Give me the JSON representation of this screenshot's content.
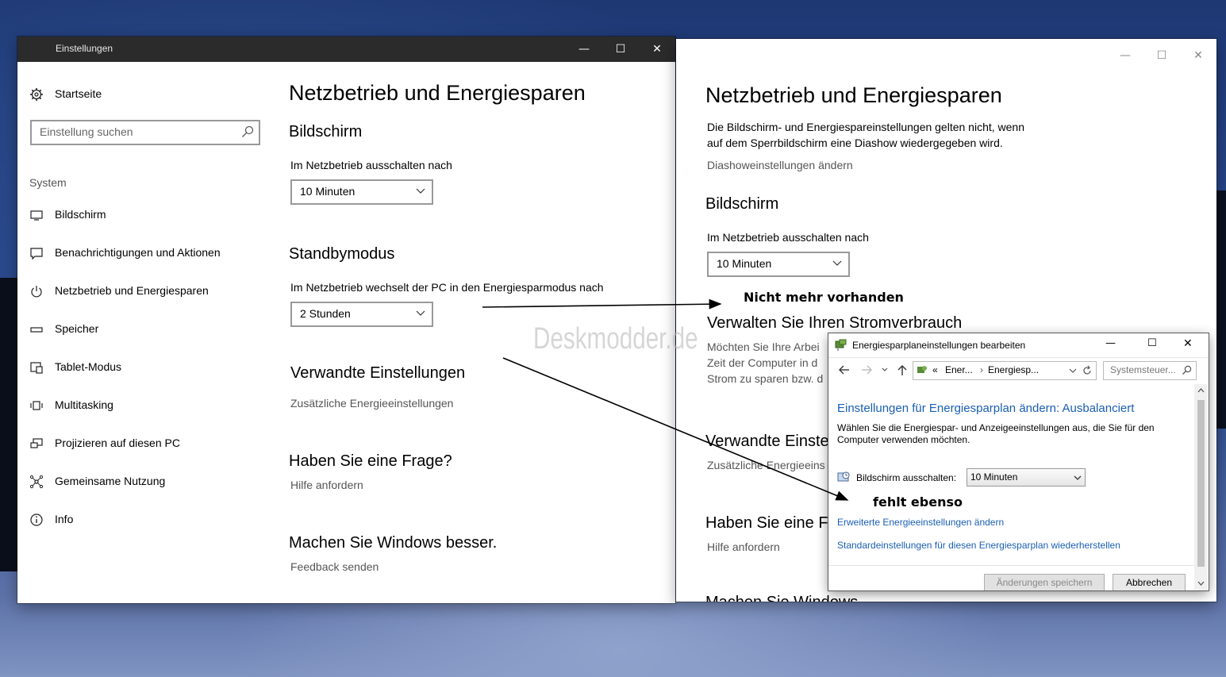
{
  "left_window": {
    "title": "Einstellungen",
    "controls": [
      "—",
      "☐",
      "✕"
    ],
    "home_label": "Startseite",
    "search_placeholder": "Einstellung suchen",
    "section_label": "System",
    "nav": [
      {
        "label": "Bildschirm",
        "icon": "monitor-icon"
      },
      {
        "label": "Benachrichtigungen und Aktionen",
        "icon": "message-icon"
      },
      {
        "label": "Netzbetrieb und Energiesparen",
        "icon": "power-icon"
      },
      {
        "label": "Speicher",
        "icon": "storage-icon"
      },
      {
        "label": "Tablet-Modus",
        "icon": "tablet-icon"
      },
      {
        "label": "Multitasking",
        "icon": "multitasking-icon"
      },
      {
        "label": "Projizieren auf diesen PC",
        "icon": "project-icon"
      },
      {
        "label": "Gemeinsame Nutzung",
        "icon": "share-icon"
      },
      {
        "label": "Info",
        "icon": "info-icon"
      }
    ],
    "page_title": "Netzbetrieb und Energiesparen",
    "screen_heading": "Bildschirm",
    "screen_label": "Im Netzbetrieb ausschalten nach",
    "screen_value": "10 Minuten",
    "standby_heading": "Standbymodus",
    "standby_label": "Im Netzbetrieb wechselt der PC in den Energiesparmodus nach",
    "standby_value": "2 Stunden",
    "related_heading": "Verwandte Einstellungen",
    "related_link": "Zusätzliche Energieeinstellungen",
    "question_heading": "Haben Sie eine Frage?",
    "question_link": "Hilfe anfordern",
    "better_heading": "Machen Sie Windows besser.",
    "better_link": "Feedback senden"
  },
  "right_window": {
    "controls": [
      "—",
      "☐",
      "✕"
    ],
    "page_title": "Netzbetrieb und Energiesparen",
    "info_line1": "Die Bildschirm- und Energiespareinstellungen gelten nicht, wenn",
    "info_line2": "auf dem Sperrbildschirm eine Diashow wiedergegeben wird.",
    "slideshow_link": "Diashoweinstellungen ändern",
    "screen_heading": "Bildschirm",
    "screen_label": "Im Netzbetrieb ausschalten nach",
    "screen_value": "10 Minuten",
    "manage_heading": "Verwalten Sie Ihren Stromverbrauch",
    "manage_line1": "Möchten Sie Ihre Arbei",
    "manage_line2": "Zeit der Computer in d",
    "manage_line3": "Strom zu sparen bzw. d",
    "related_heading": "Verwandte Einste",
    "related_link": "Zusätzliche Energieeins",
    "question_heading": "Haben Sie eine Fr",
    "question_link": "Hilfe anfordern",
    "better_heading": "Machen Sie Windows"
  },
  "dialog": {
    "title": "Energiesparplaneinstellungen bearbeiten",
    "controls": [
      "—",
      "☐",
      "✕"
    ],
    "address_prefix": "«",
    "address_part1": "Ener...",
    "address_part2": "Energiesp...",
    "search_placeholder": "Systemsteuer...",
    "heading": "Einstellungen für Energiesparplan ändern: Ausbalanciert",
    "desc_line1": "Wählen Sie die Energiespar- und Anzeigeeinstellungen aus, die Sie für den",
    "desc_line2": "Computer verwenden möchten.",
    "screen_off_label": "Bildschirm ausschalten:",
    "screen_off_value": "10 Minuten",
    "advanced_link": "Erweiterte Energieeinstellungen ändern",
    "restore_link": "Standardeinstellungen für diesen Energiesparplan wiederherstellen",
    "save_button": "Änderungen speichern",
    "cancel_button": "Abbrechen"
  },
  "annotations": {
    "missing": "Nicht mehr vorhanden",
    "also_missing": "fehlt ebenso",
    "watermark": "Deskmodder.de"
  }
}
